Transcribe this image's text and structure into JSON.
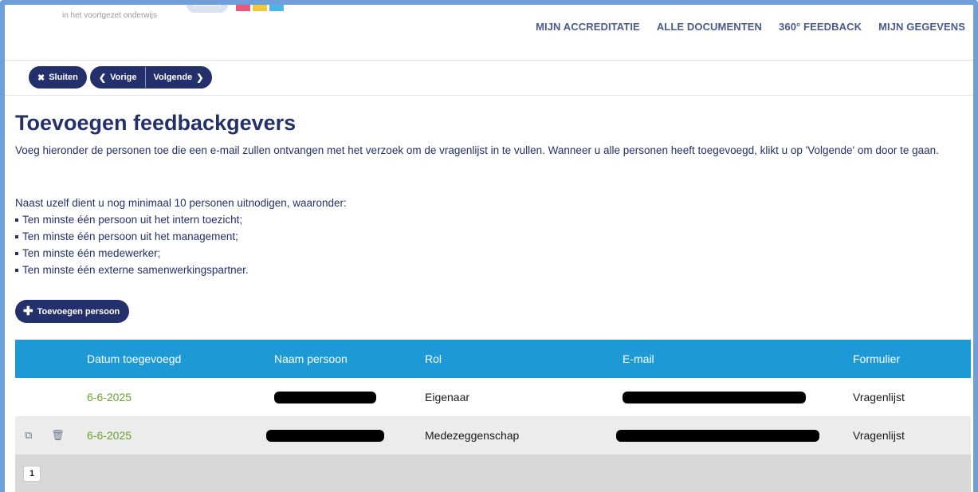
{
  "header": {
    "logo_subtitle": "in het voortgezet onderwijs",
    "logo_bar_colors": [
      "#e85a7a",
      "#f0c93b",
      "#4db6e6"
    ],
    "nav": [
      {
        "label": "MIJN ACCREDITATIE"
      },
      {
        "label": "ALLE DOCUMENTEN"
      },
      {
        "label": "360° FEEDBACK"
      },
      {
        "label": "MIJN GEGEVENS"
      }
    ]
  },
  "toolbar": {
    "close_label": "Sluiten",
    "close_icon": "close-icon",
    "prev_label": "Vorige",
    "prev_icon": "chevron-left-icon",
    "next_label": "Volgende",
    "next_icon": "chevron-right-icon"
  },
  "page": {
    "title": "Toevoegen feedbackgevers",
    "intro": "Voeg hieronder de personen toe die een e-mail zullen ontvangen met het verzoek om de vragenlijst in te vullen. Wanneer u alle personen heeft toegevoegd, klikt u op 'Volgende' om door te gaan.",
    "requirements_intro": "Naast uzelf dient u nog minimaal 10 personen uitnodigen, waaronder:",
    "requirements": [
      "Ten minste één persoon uit het intern toezicht;",
      "Ten minste één persoon uit het management;",
      "Ten minste één medewerker;",
      "Ten minste één externe samenwerkingspartner."
    ],
    "add_button": "Toevoegen persoon"
  },
  "table": {
    "headers": {
      "date": "Datum toegevoegd",
      "name": "Naam persoon",
      "rol": "Rol",
      "email": "E-mail",
      "form": "Formulier"
    },
    "rows": [
      {
        "date": "6-6-2025",
        "rol": "Eigenaar",
        "form": "Vragenlijst",
        "has_actions": false
      },
      {
        "date": "6-6-2025",
        "rol": "Medezeggenschap",
        "form": "Vragenlijst",
        "has_actions": true
      }
    ],
    "pagination": {
      "current_page": "1"
    }
  },
  "colors": {
    "navy": "#23306b",
    "table_header": "#1d9ad6",
    "date_green": "#6aa12d",
    "frame": "#6f9fd8"
  }
}
